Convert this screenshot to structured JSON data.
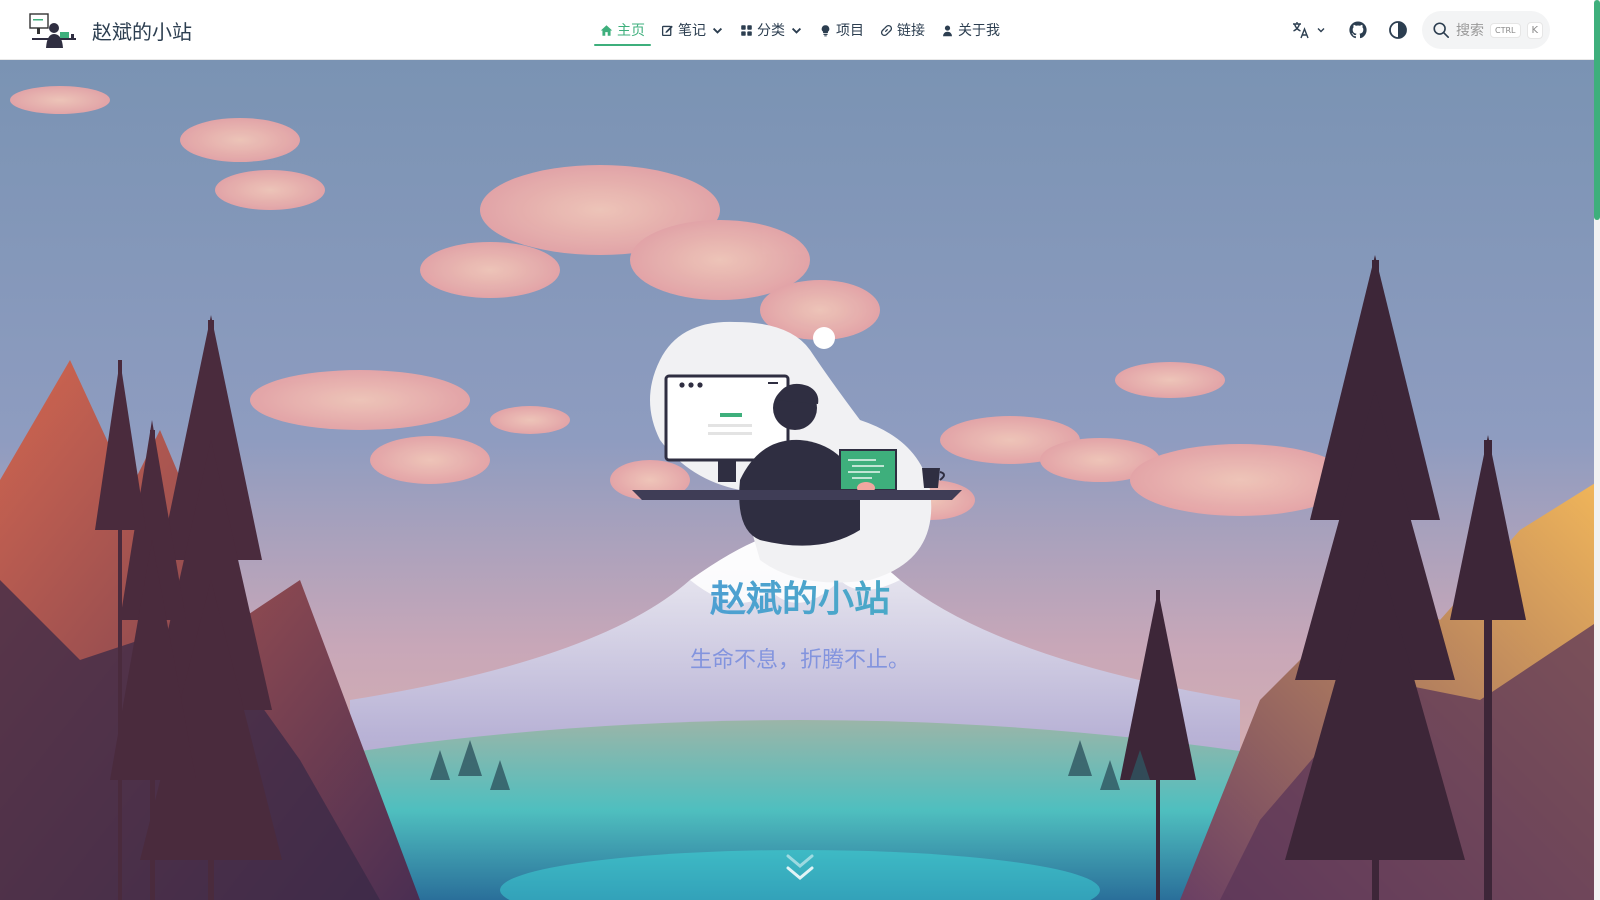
{
  "site": {
    "title": "赵斌的小站"
  },
  "nav": {
    "items": [
      {
        "label": "主页",
        "icon": "home-icon",
        "active": true
      },
      {
        "label": "笔记",
        "icon": "edit-icon",
        "dropdown": true
      },
      {
        "label": "分类",
        "icon": "grid-icon",
        "dropdown": true
      },
      {
        "label": "项目",
        "icon": "bulb-icon"
      },
      {
        "label": "链接",
        "icon": "link-icon"
      },
      {
        "label": "关于我",
        "icon": "user-icon"
      }
    ]
  },
  "toolbar": {
    "language_icon": "translate-icon",
    "github_icon": "github-icon",
    "theme_icon": "contrast-icon",
    "search_placeholder": "搜索",
    "search_shortcut_mod": "CTRL",
    "search_shortcut_key": "K"
  },
  "hero": {
    "title": "赵斌的小站",
    "description": "生命不息，折腾不止。"
  },
  "colors": {
    "accent": "#3eaf7c",
    "text": "#2c3e50",
    "sky": "#7a93b3",
    "title_gradient_start": "#5c7cfa",
    "title_gradient_end": "#3eaf7c"
  }
}
